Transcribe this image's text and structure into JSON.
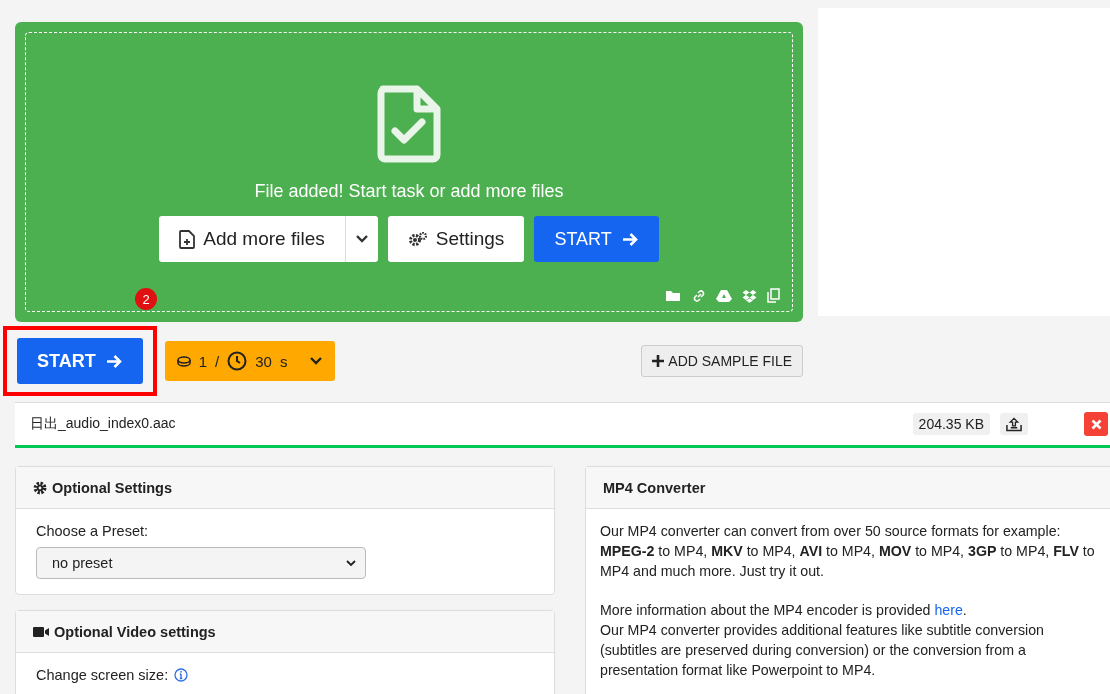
{
  "dropzone": {
    "message": "File added! Start task or add more files",
    "add_button": "Add more files",
    "settings_button": "Settings",
    "start_button": "START"
  },
  "annotation": {
    "step": "2",
    "highlighted": true
  },
  "toolbar": {
    "start_button": "START",
    "credits": "1",
    "separator": "/",
    "duration": "30",
    "unit": "s",
    "sample_button": "ADD SAMPLE FILE"
  },
  "file": {
    "name": "日出_audio_index0.aac",
    "size": "204.35 KB",
    "level": 1
  },
  "optional_settings": {
    "title": "Optional Settings",
    "preset_label": "Choose a Preset:",
    "preset_value": "no preset"
  },
  "video_settings": {
    "title": "Optional Video settings",
    "screen_size_label": "Change screen size:"
  },
  "converter": {
    "title": "MP4 Converter",
    "intro": "Our MP4 converter can convert from over 50 source formats for example: **MPEG-2** to MP4, **MKV** to MP4, **AVI** to MP4, **MOV** to MP4, **3GP** to MP4, **FLV** to MP4 and much more. Just try it out.",
    "info_before": "More information about the MP4 encoder is provided ",
    "info_link": "here",
    "info_after": ".",
    "features": "Our MP4 converter provides additional features like subtitle conversion (subtitles are preserved during conversion) or the conversion from a presentation format like Powerpoint to MP4."
  }
}
